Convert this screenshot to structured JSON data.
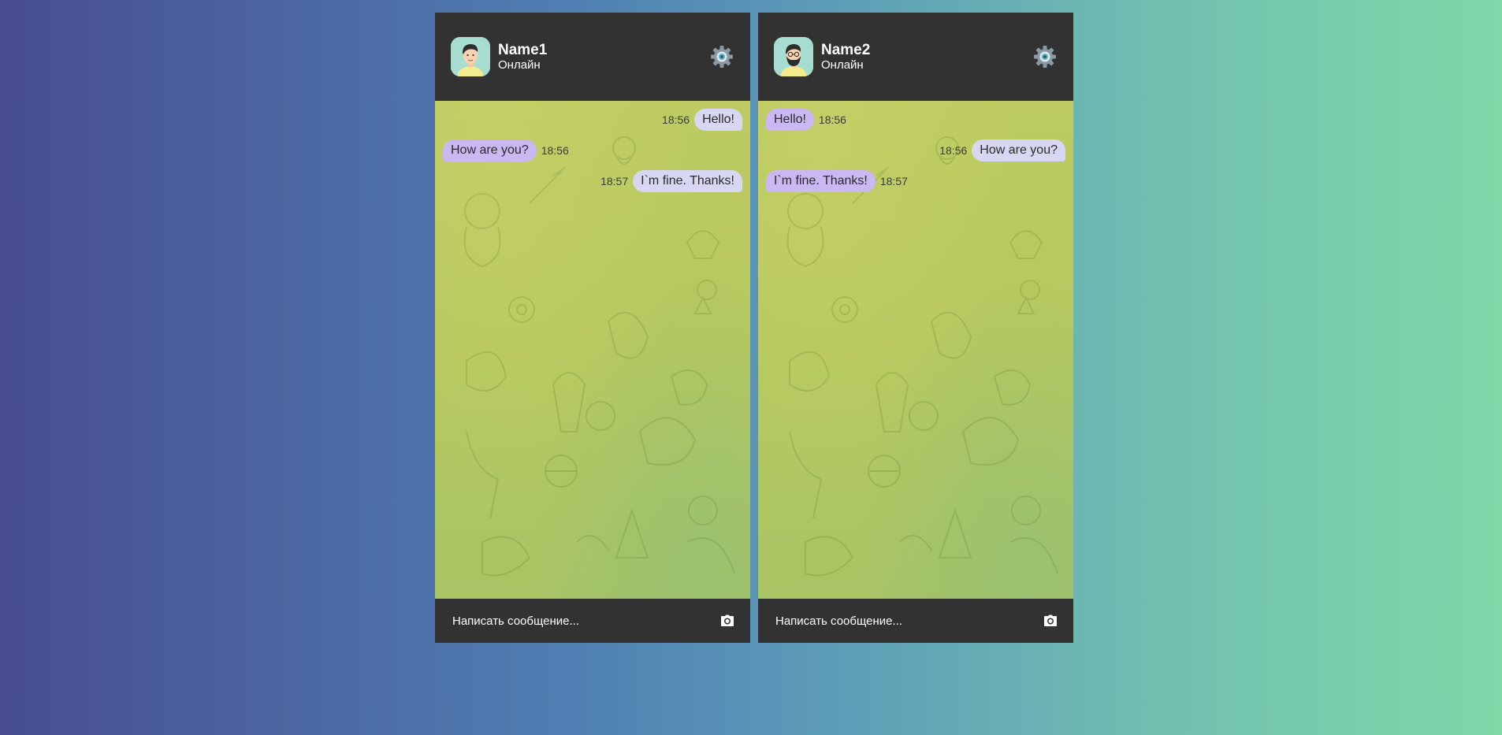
{
  "chats": [
    {
      "user": {
        "name": "Name1",
        "status": "Онлайн",
        "avatar_icon": "man-avatar-icon"
      },
      "settings_icon": "gear-icon",
      "messages": [
        {
          "direction": "out",
          "text": "Hello!",
          "time": "18:56"
        },
        {
          "direction": "in",
          "text": "How are you?",
          "time": "18:56"
        },
        {
          "direction": "out",
          "text": "I`m fine. Thanks!",
          "time": "18:57"
        }
      ],
      "composer": {
        "placeholder": "Написать сообщение...",
        "camera_icon": "camera-icon"
      }
    },
    {
      "user": {
        "name": "Name2",
        "status": "Онлайн",
        "avatar_icon": "bearded-man-avatar-icon"
      },
      "settings_icon": "gear-icon",
      "messages": [
        {
          "direction": "in",
          "text": "Hello!",
          "time": "18:56"
        },
        {
          "direction": "out",
          "text": "How are you?",
          "time": "18:56"
        },
        {
          "direction": "in",
          "text": "I`m fine. Thanks!",
          "time": "18:57"
        }
      ],
      "composer": {
        "placeholder": "Написать сообщение...",
        "camera_icon": "camera-icon"
      }
    }
  ],
  "colors": {
    "header": "#323232",
    "chat_background": "#b8c95f",
    "outgoing_bubble": "#d8d7f3",
    "incoming_bubble": "#c9b8f1",
    "avatar_background": "#a7ddd0"
  }
}
